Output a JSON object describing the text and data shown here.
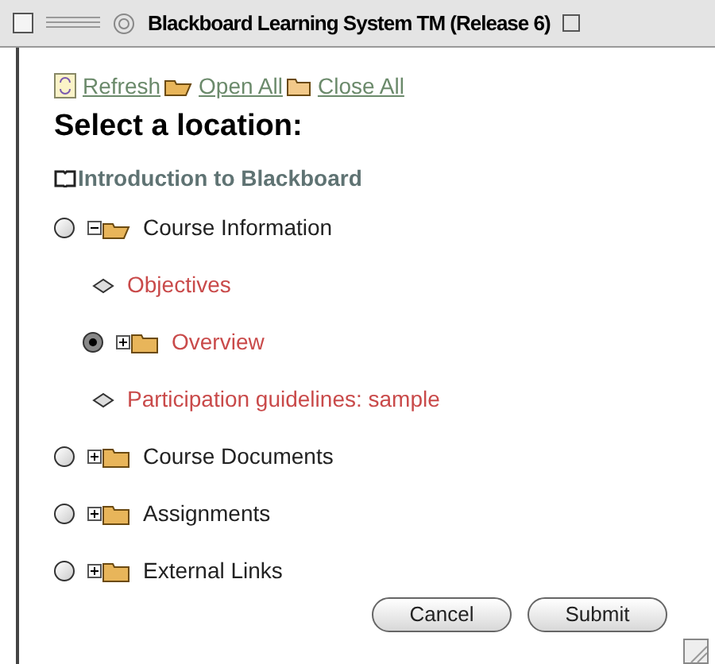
{
  "window": {
    "title": "Blackboard Learning System TM (Release 6)"
  },
  "toolbar": [
    {
      "kind": "refresh",
      "label": "Refresh"
    },
    {
      "kind": "open",
      "label": "Open All"
    },
    {
      "kind": "close",
      "label": "Close All"
    }
  ],
  "heading": "Select a location:",
  "course": "Introduction to Blackboard",
  "tree": [
    {
      "kind": "folder",
      "label": "Course Information",
      "selected": false,
      "expanded": true,
      "children": [
        {
          "kind": "item",
          "label": "Objectives"
        },
        {
          "kind": "folder",
          "label": "Overview",
          "selected": true,
          "expanded": false
        },
        {
          "kind": "item",
          "label": "Participation guidelines: sample"
        }
      ]
    },
    {
      "kind": "folder",
      "label": "Course Documents",
      "selected": false,
      "expanded": false
    },
    {
      "kind": "folder",
      "label": "Assignments",
      "selected": false,
      "expanded": false
    },
    {
      "kind": "folder",
      "label": "External Links",
      "selected": false,
      "expanded": false
    }
  ],
  "buttons": [
    "Cancel",
    "Submit"
  ]
}
